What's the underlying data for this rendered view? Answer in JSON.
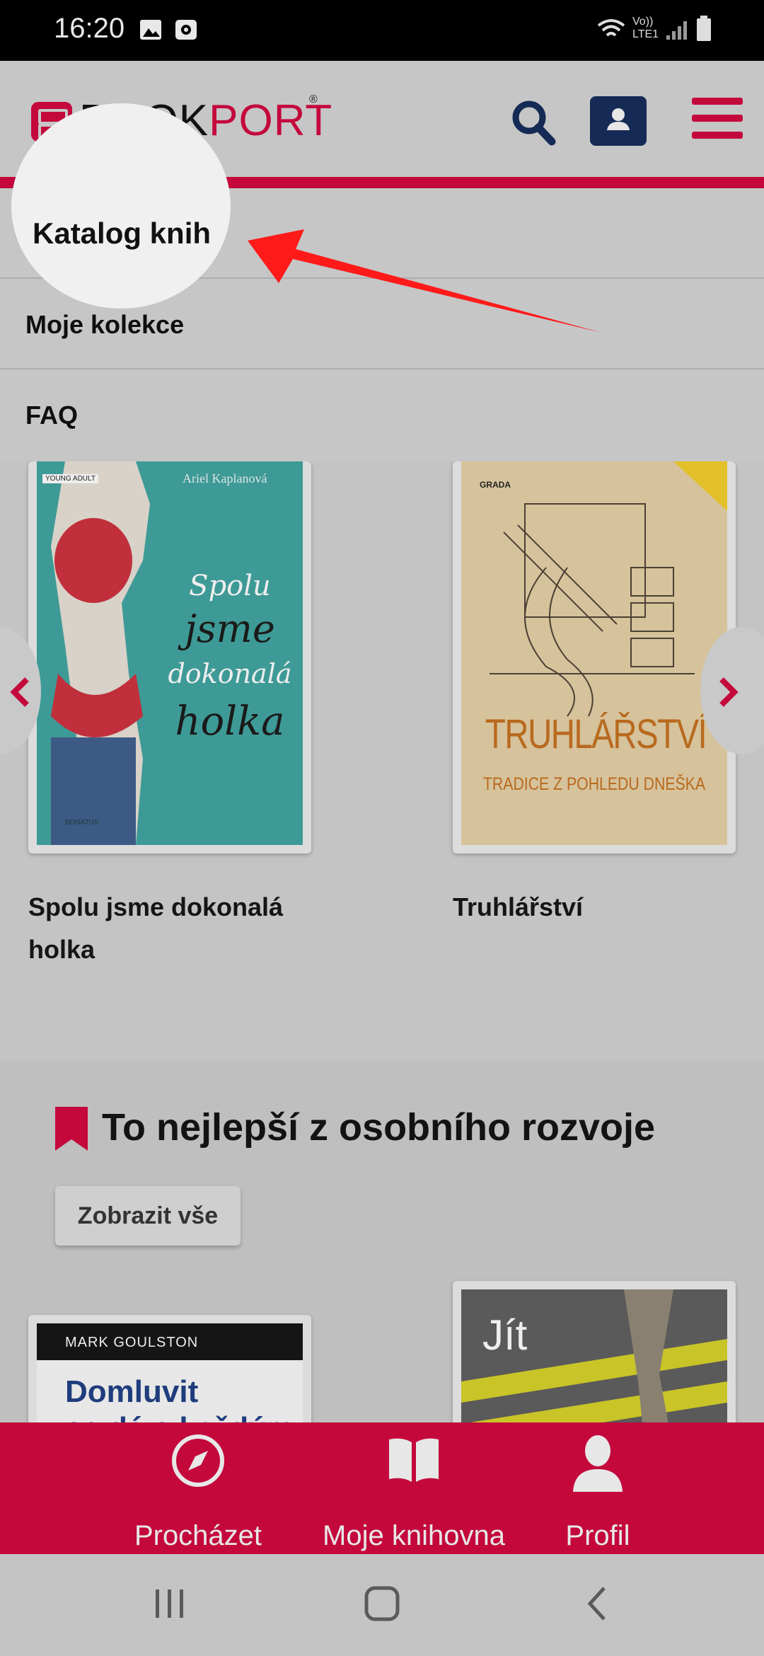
{
  "status_bar": {
    "time": "16:20",
    "network_label": "Vo)) LTE1"
  },
  "header": {
    "logo_book": "BOOK",
    "logo_port": "PORT",
    "logo_reg": "®",
    "accent_color": "#c4083c",
    "profile_button_color": "#152a55"
  },
  "menu": {
    "items": [
      {
        "label": "Katalog knih"
      },
      {
        "label": "Moje kolekce"
      },
      {
        "label": "FAQ"
      }
    ]
  },
  "books_top": [
    {
      "title": "Spolu jsme dokonalá holka",
      "title_line1": "Spolu jsme dokonalá",
      "title_line2": "holka",
      "cover_author": "Ariel Kaplanová",
      "cover_series": "YOUNG ADULT",
      "cover_words": [
        "Spolu",
        "jsme",
        "dokonalá",
        "holka"
      ],
      "cover_publisher": "BONATUS"
    },
    {
      "title": "Truhlářství",
      "cover_publisher": "GRADA",
      "cover_title": "TRUHLÁŘSTVÍ",
      "cover_subtitle": "TRADICE Z POHLEDU DNEŠKA"
    }
  ],
  "section": {
    "title": "To nejlepší z osobního rozvoje",
    "show_all": "Zobrazit vše"
  },
  "books_bottom": [
    {
      "cover_author": "MARK GOULSTON",
      "cover_title_line1": "Domluvit",
      "cover_title_line2": "se dá s každým"
    },
    {
      "cover_title": "Jít"
    }
  ],
  "bottom_nav": {
    "items": [
      {
        "label": "Procházet",
        "icon": "compass-icon"
      },
      {
        "label": "Moje knihovna",
        "icon": "book-icon"
      },
      {
        "label": "Profil",
        "icon": "person-icon"
      }
    ]
  }
}
